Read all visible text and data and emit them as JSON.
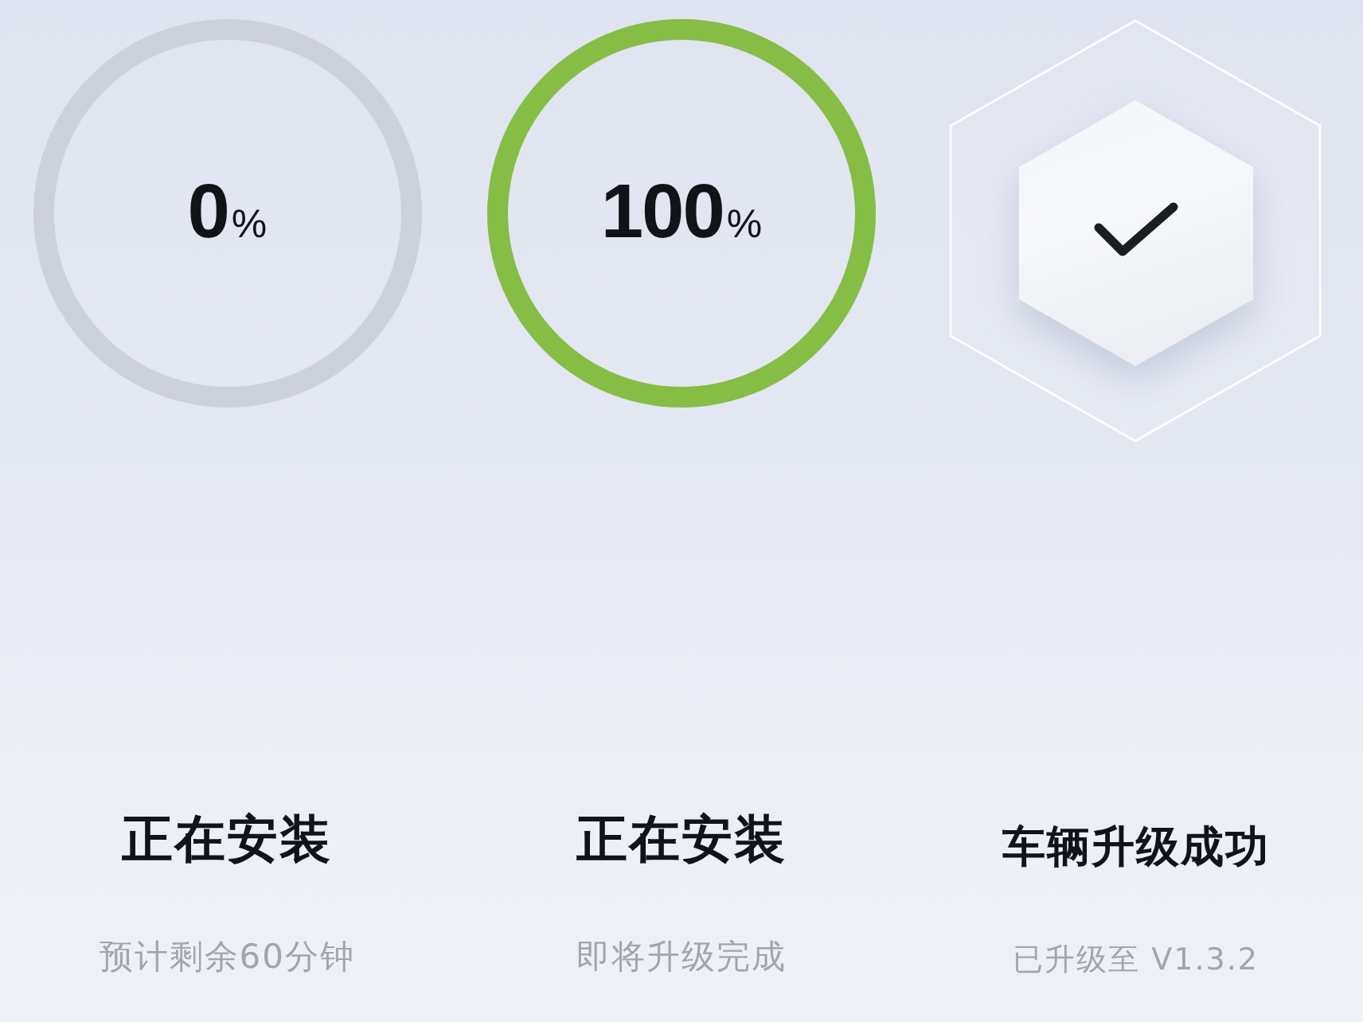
{
  "steps": [
    {
      "kind": "progress",
      "level": 0,
      "value": "0",
      "unit": "%",
      "title": "正在安装",
      "subtitle": "预计剩余60分钟"
    },
    {
      "kind": "progress",
      "level": 1,
      "value": "100",
      "unit": "%",
      "title": "正在安装",
      "subtitle": "即将升级完成"
    },
    {
      "kind": "success",
      "title": "车辆升级成功",
      "subtitle": "已升级至 V1.3.2"
    }
  ]
}
